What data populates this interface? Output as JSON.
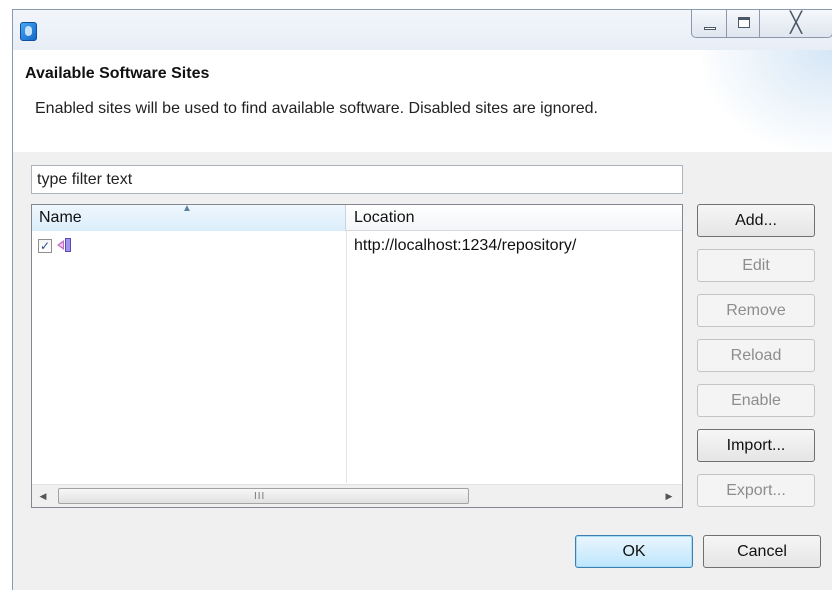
{
  "titlebar": {
    "app_icon": "eclipse-icon",
    "minimize_icon": "minimize-icon",
    "maximize_icon": "maximize-icon",
    "close_icon": "close-icon",
    "close_glyph": "╳"
  },
  "banner": {
    "title": "Available Software Sites",
    "description": "Enabled sites will be used to find available software.  Disabled sites are ignored."
  },
  "filter": {
    "value": "type filter text"
  },
  "table": {
    "columns": [
      "Name",
      "Location"
    ],
    "sorted_column": "Name",
    "rows": [
      {
        "checked": true,
        "check_glyph": "✓",
        "icon": "update-site-icon",
        "name": "",
        "location": "http://localhost:1234/repository/"
      }
    ],
    "scrollbar": {
      "left_arrow": "◀",
      "right_arrow": "▶",
      "grip": "III"
    }
  },
  "side_buttons": [
    {
      "label": "Add...",
      "enabled": true
    },
    {
      "label": "Edit",
      "enabled": false
    },
    {
      "label": "Remove",
      "enabled": false
    },
    {
      "label": "Reload",
      "enabled": false
    },
    {
      "label": "Enable",
      "enabled": false
    },
    {
      "label": "Import...",
      "enabled": true
    },
    {
      "label": "Export...",
      "enabled": false
    }
  ],
  "footer": {
    "ok_label": "OK",
    "cancel_label": "Cancel"
  },
  "colors": {
    "ok_border": "#3c7fb1",
    "disabled_text": "#8d8d8d",
    "header_sorted_bg": "#dbeefb"
  }
}
